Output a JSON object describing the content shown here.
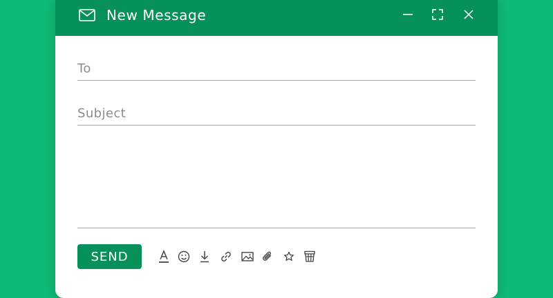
{
  "window": {
    "title": "New Message",
    "icons": {
      "title": "mail-icon",
      "minimize": "minimize-icon",
      "maximize": "expand-icon",
      "close": "close-icon"
    }
  },
  "compose": {
    "to_placeholder": "To",
    "to_value": "",
    "subject_placeholder": "Subject",
    "subject_value": "",
    "body_value": ""
  },
  "footer": {
    "send_label": "SEND",
    "tools": [
      "text-format-icon",
      "emoji-icon",
      "download-icon",
      "link-icon",
      "image-icon",
      "attachment-icon",
      "star-icon",
      "template-icon"
    ]
  },
  "colors": {
    "background": "#0fbb74",
    "titlebar": "#08905a",
    "send_button": "#08905a",
    "divider": "#a4a4a4",
    "placeholder": "#8c8c8c"
  }
}
